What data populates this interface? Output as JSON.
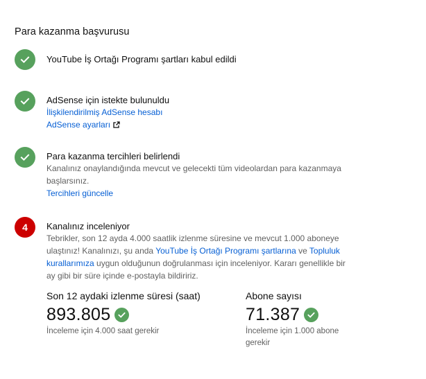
{
  "page_title": "Para kazanma başvurusu",
  "colors": {
    "success": "#57a15d",
    "pending": "#cc0000",
    "link": "#065fd4",
    "secondary_text": "#606060"
  },
  "steps": [
    {
      "status": "complete",
      "icon": "check-icon",
      "heading": "YouTube İş Ortağı Programı şartları kabul edildi"
    },
    {
      "status": "complete",
      "icon": "check-icon",
      "heading": "AdSense için istekte bulunuldu",
      "links": [
        {
          "label": "İlişkilendirilmiş AdSense hesabı"
        },
        {
          "label": "AdSense ayarları",
          "icon": "external-link-icon"
        }
      ]
    },
    {
      "status": "complete",
      "icon": "check-icon",
      "heading": "Para kazanma tercihleri belirlendi",
      "description": "Kanalınız onaylandığında mevcut ve gelecekti tüm videolardan para kazanmaya başlarsınız.",
      "links": [
        {
          "label": "Tercihleri güncelle"
        }
      ]
    },
    {
      "status": "in_review",
      "number": "4",
      "heading": "Kanalınız inceleniyor",
      "description_part1": "Tebrikler, son 12 ayda 4.000 saatlik izlenme süresine ve mevcut 1.000 aboneye ulaştınız! Kanalınızı, şu anda ",
      "description_link1": "YouTube İş Ortağı Programı şartlarına",
      "description_part2": " ve ",
      "description_link2": "Topluluk kurallarımıza",
      "description_part3": " uygun olduğunun doğrulanması için inceleniyor. Kararı genellikle bir ay gibi bir süre içinde e-postayla bildiririz."
    }
  ],
  "stats": [
    {
      "label": "Son 12 aydaki izlenme süresi (saat)",
      "value": "893.805",
      "icon": "check-icon",
      "note": "İnceleme için 4.000 saat gerekir"
    },
    {
      "label": "Abone sayısı",
      "value": "71.387",
      "icon": "check-icon",
      "note": "İnceleme için 1.000 abone gerekir"
    }
  ]
}
